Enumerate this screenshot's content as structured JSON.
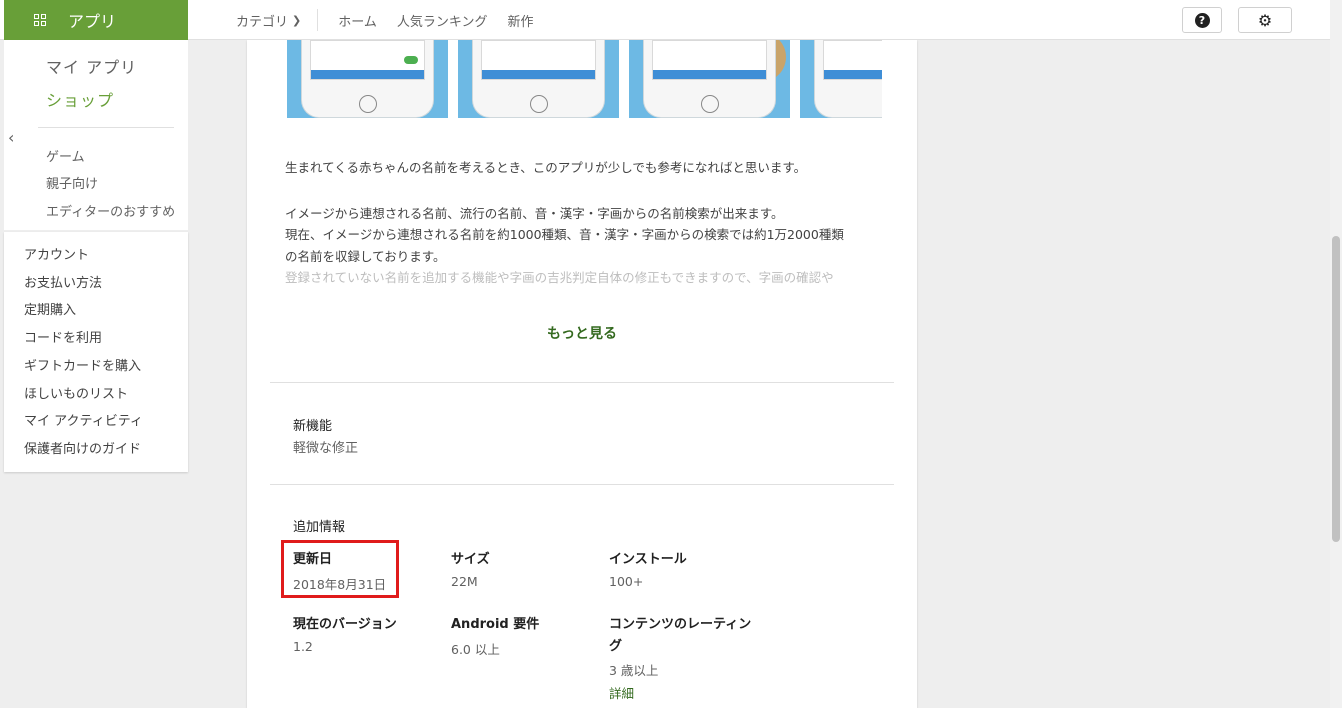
{
  "topbar": {
    "apps_label": "アプリ",
    "category_label": "カテゴリ",
    "nav_links": [
      "ホーム",
      "人気ランキング",
      "新作"
    ],
    "help_glyph": "?",
    "settings_icon": "gear-icon"
  },
  "sidebar": {
    "my_apps": "マイ アプリ",
    "shop": "ショップ",
    "sub_items": [
      "ゲーム",
      "親子向け",
      "エディターのおすすめ"
    ],
    "account_items": [
      "アカウント",
      "お支払い方法",
      "定期購入",
      "コードを利用",
      "ギフトカードを購入",
      "ほしいものリスト",
      "マイ アクティビティ",
      "保護者向けのガイド"
    ],
    "accent_color": "#689f38"
  },
  "description": {
    "lines": [
      "生まれてくる赤ちゃんの名前を考えるとき、このアプリが少しでも参考になればと思います。",
      "イメージから連想される名前、流行の名前、音・漢字・字画からの名前検索が出来ます。",
      "現在、イメージから連想される名前を約1000種類、音・漢字・字画からの検索では約1万2000種類",
      "の名前を収録しております。",
      "登録されていない名前を追加する機能や字画の吉兆判定自体の修正もできますので、字画の確認や"
    ],
    "more_label": "もっと見る"
  },
  "whats_new": {
    "title": "新機能",
    "text": "軽微な修正"
  },
  "additional_info": {
    "title": "追加情報",
    "updated_label": "更新日",
    "updated_value": "2018年8月31日",
    "size_label": "サイズ",
    "size_value": "22M",
    "installs_label": "インストール",
    "installs_value": "100+",
    "version_label": "現在のバージョン",
    "version_value": "1.2",
    "android_label": "Android 要件",
    "android_value": "6.0 以上",
    "rating_label_line1": "コンテンツのレーティン",
    "rating_label_line2": "グ",
    "rating_value": "3 歳以上",
    "details_link": "詳細",
    "highlight_color": "#e01b1b"
  }
}
